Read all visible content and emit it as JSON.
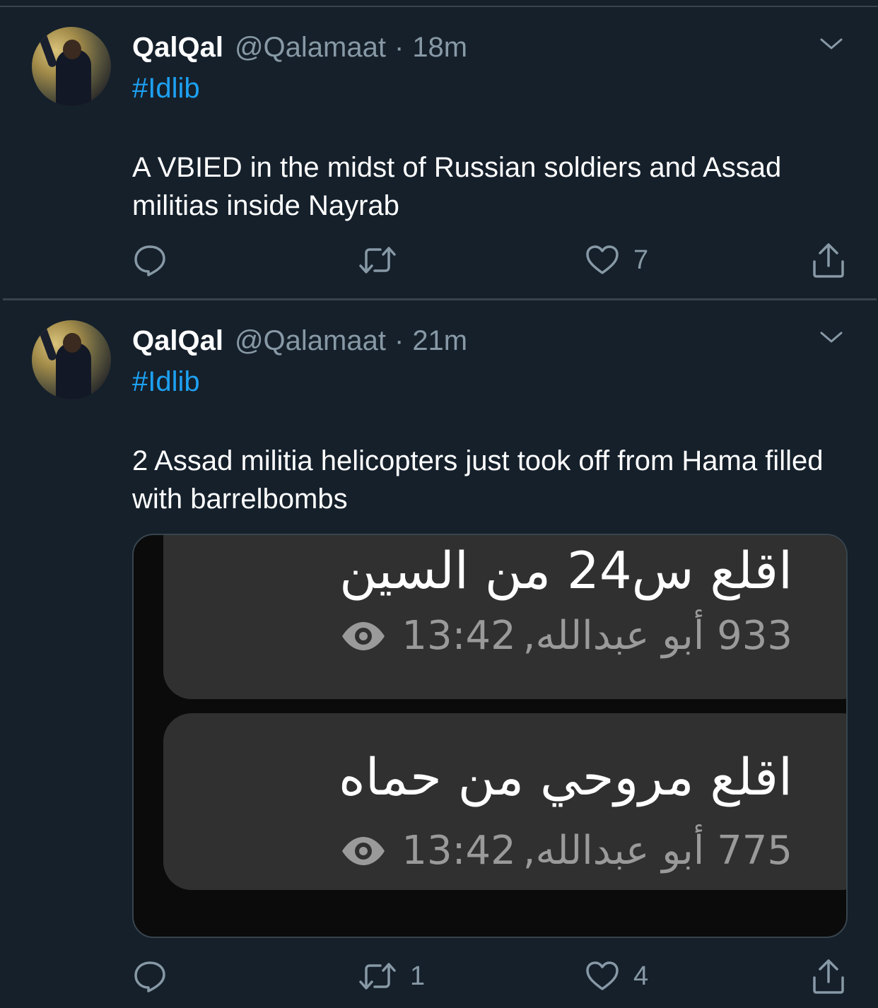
{
  "tweets": [
    {
      "author_name": "QalQal",
      "author_handle": "@Qalamaat",
      "separator": "·",
      "time": "18m",
      "hashtag": "#Idlib",
      "text": "A VBIED in the midst of Russian soldiers and Assad militias inside Nayrab",
      "replies": "",
      "retweets": "",
      "likes": "7"
    },
    {
      "author_name": "QalQal",
      "author_handle": "@Qalamaat",
      "separator": "·",
      "time": "21m",
      "hashtag": "#Idlib",
      "text": "2 Assad militia helicopters just took off from Hama filled with barrelbombs",
      "replies": "",
      "retweets": "1",
      "likes": "4",
      "media": {
        "messages": [
          {
            "text": "اقلع س24 من السين",
            "sender": "933 أبو عبدالله,",
            "time": "13:42"
          },
          {
            "text": "اقلع مروحي من حماه",
            "sender": "775 أبو عبدالله,",
            "time": "13:42"
          }
        ]
      }
    }
  ],
  "icons": {
    "reply": "reply-icon",
    "retweet": "retweet-icon",
    "like": "heart-icon",
    "share": "share-icon",
    "more": "chevron-down-icon",
    "views": "eye-icon"
  },
  "colors": {
    "background": "#15202b",
    "link": "#1da1f2",
    "muted": "#8899a6",
    "divider": "#38444d"
  }
}
